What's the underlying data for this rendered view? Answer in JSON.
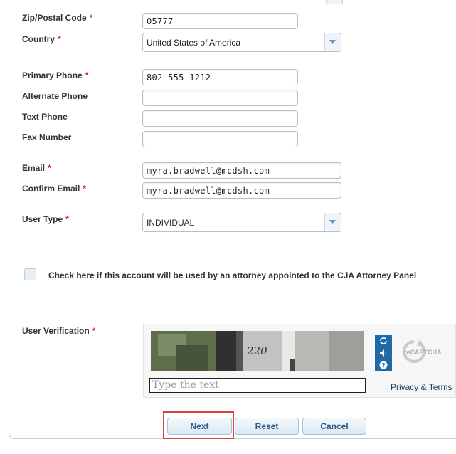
{
  "form": {
    "zip": {
      "label": "Zip/Postal Code",
      "required": "*",
      "value": "05777"
    },
    "country": {
      "label": "Country",
      "required": "*",
      "value": "United States of America"
    },
    "primary_phone": {
      "label": "Primary Phone",
      "required": "*",
      "value": "802-555-1212"
    },
    "alternate_phone": {
      "label": "Alternate Phone",
      "value": ""
    },
    "text_phone": {
      "label": "Text Phone",
      "value": ""
    },
    "fax_number": {
      "label": "Fax Number",
      "value": ""
    },
    "email": {
      "label": "Email",
      "required": "*",
      "value": "myra.bradwell@mcdsh.com"
    },
    "confirm_email": {
      "label": "Confirm Email",
      "required": "*",
      "value": "myra.bradwell@mcdsh.com"
    },
    "user_type": {
      "label": "User Type",
      "required": "*",
      "value": "INDIVIDUAL"
    },
    "cja_checkbox": {
      "label": "Check here if this account will be used by an attorney appointed to the CJA Attorney Panel"
    },
    "user_verification": {
      "label": "User Verification",
      "required": "*"
    }
  },
  "captcha": {
    "image_text": "220",
    "placeholder": "Type the text",
    "logo_text": "reCAPTCHA",
    "privacy_label": "Privacy & Terms",
    "icons": [
      "refresh-icon",
      "audio-icon",
      "help-icon"
    ]
  },
  "buttons": {
    "next": "Next",
    "reset": "Reset",
    "cancel": "Cancel"
  },
  "colors": {
    "required": "#d9261c",
    "button_text": "#2a5a8a",
    "highlight": "#d9453a"
  }
}
